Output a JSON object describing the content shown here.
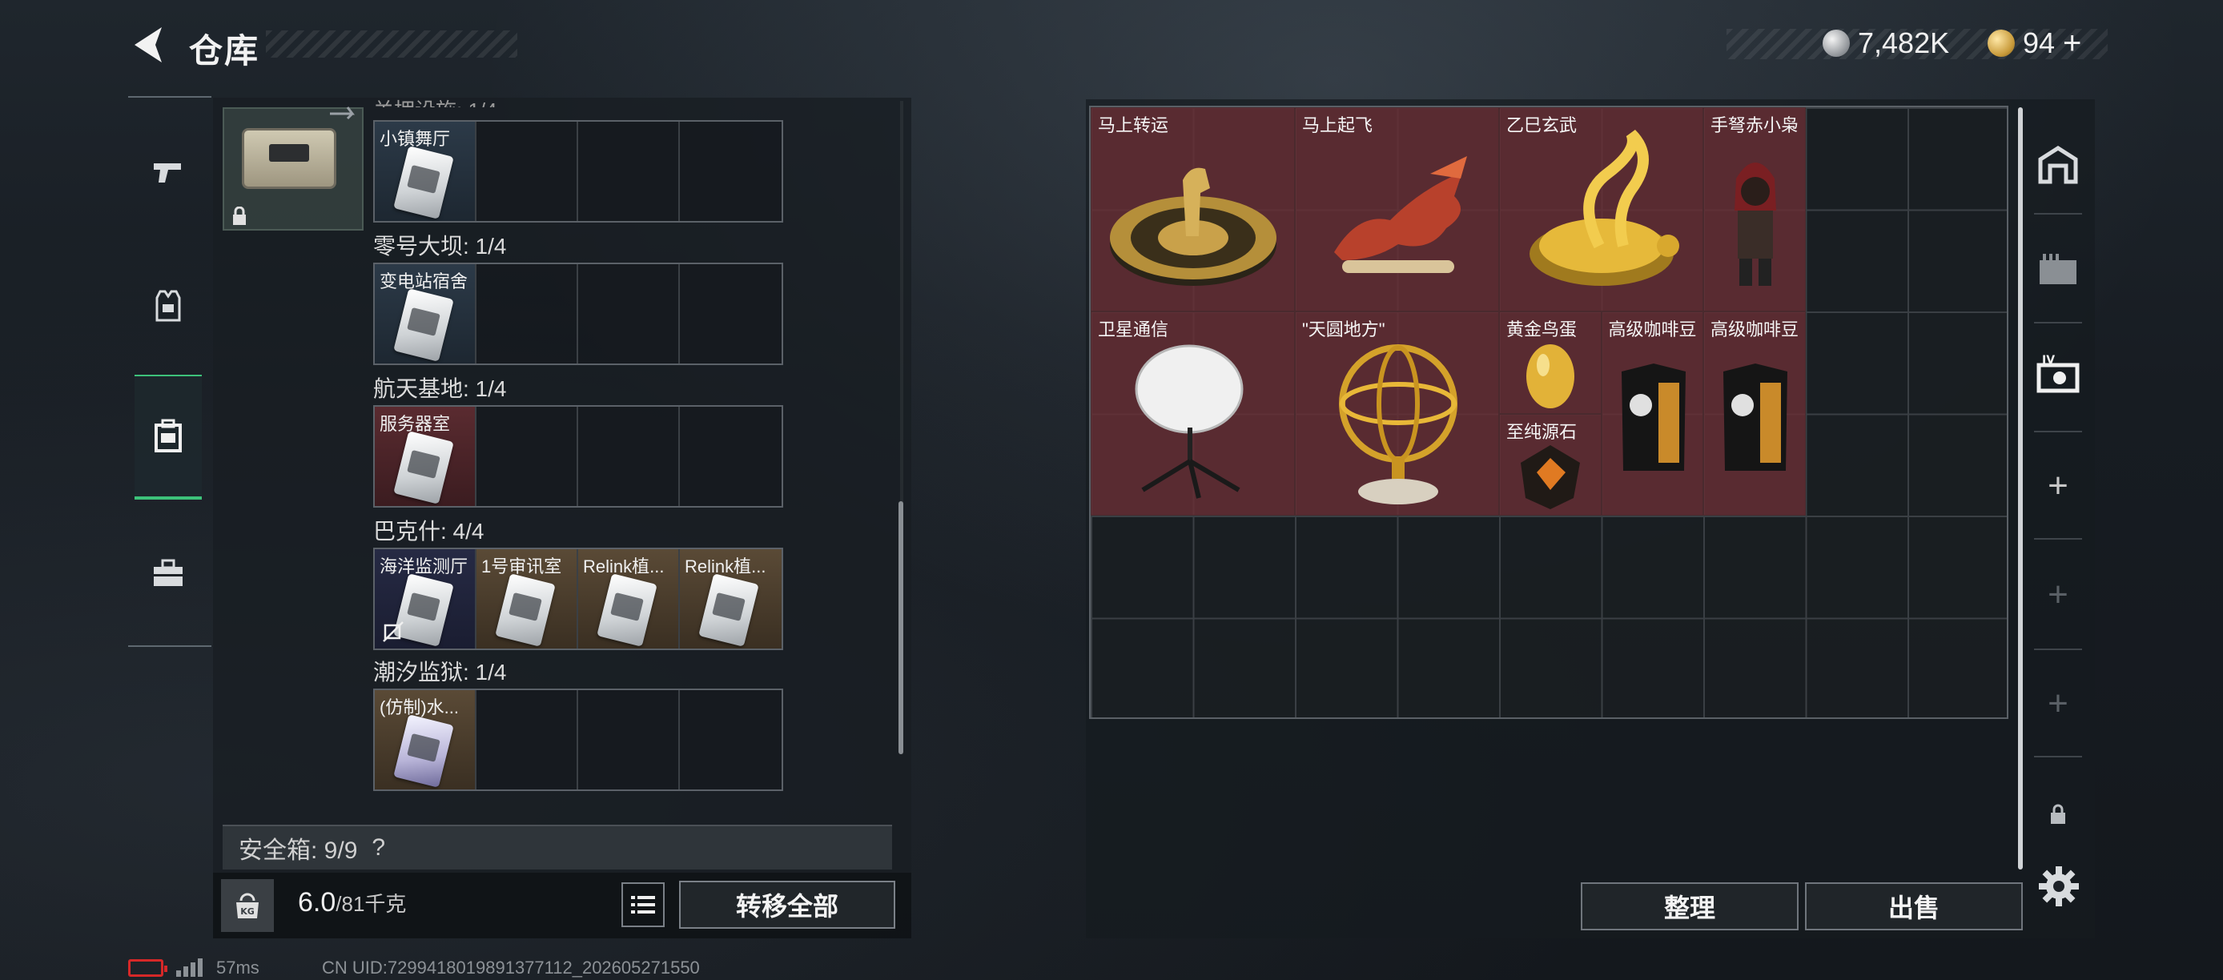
{
  "header": {
    "title": "仓库",
    "currency_silver": "7,482K",
    "currency_gold": "94",
    "currency_gold_suffix": "+"
  },
  "left": {
    "rows": [
      {
        "label": "",
        "slots": [
          {
            "name": "小镇舞厅",
            "color": "blue"
          }
        ]
      },
      {
        "label": "零号大坝: 1/4",
        "slots": [
          {
            "name": "变电站宿舍",
            "color": "blue"
          }
        ]
      },
      {
        "label": "航天基地: 1/4",
        "slots": [
          {
            "name": "服务器室",
            "color": "red"
          }
        ]
      },
      {
        "label": "巴克什: 4/4",
        "slots": [
          {
            "name": "海洋监测厅",
            "color": "navy"
          },
          {
            "name": "1号审讯室",
            "color": "tan"
          },
          {
            "name": "Relink植...",
            "color": "tan"
          },
          {
            "name": "Relink植...",
            "color": "tan"
          }
        ]
      },
      {
        "label": "潮汐监狱: 1/4",
        "slots": [
          {
            "name": "(仿制)水...",
            "color": "tan"
          }
        ]
      }
    ],
    "safe_box_label": "安全箱: 9/9",
    "safe_box_help": "?",
    "weight_current": "6.0",
    "weight_max": "/81千克",
    "weight_icon_text": "KG",
    "transfer_all": "转移全部"
  },
  "right": {
    "items": [
      {
        "name": "马上转运"
      },
      {
        "name": "马上起飞"
      },
      {
        "name": "乙巳玄武"
      },
      {
        "name": "手弩赤小枭"
      },
      {
        "name": "卫星通信"
      },
      {
        "name": "\"天圆地方\""
      },
      {
        "name": "黄金鸟蛋"
      },
      {
        "name": "至纯源石"
      },
      {
        "name": "高级咖啡豆"
      },
      {
        "name": "高级咖啡豆"
      }
    ],
    "sort": "整理",
    "sell": "出售"
  },
  "status": {
    "ping": "57ms",
    "uid": "CN UID:7299418019891377112_202605271550"
  },
  "colors": {
    "accent_green": "#3dc27a",
    "item_red": "#682e34",
    "battery_red": "#d62828"
  }
}
